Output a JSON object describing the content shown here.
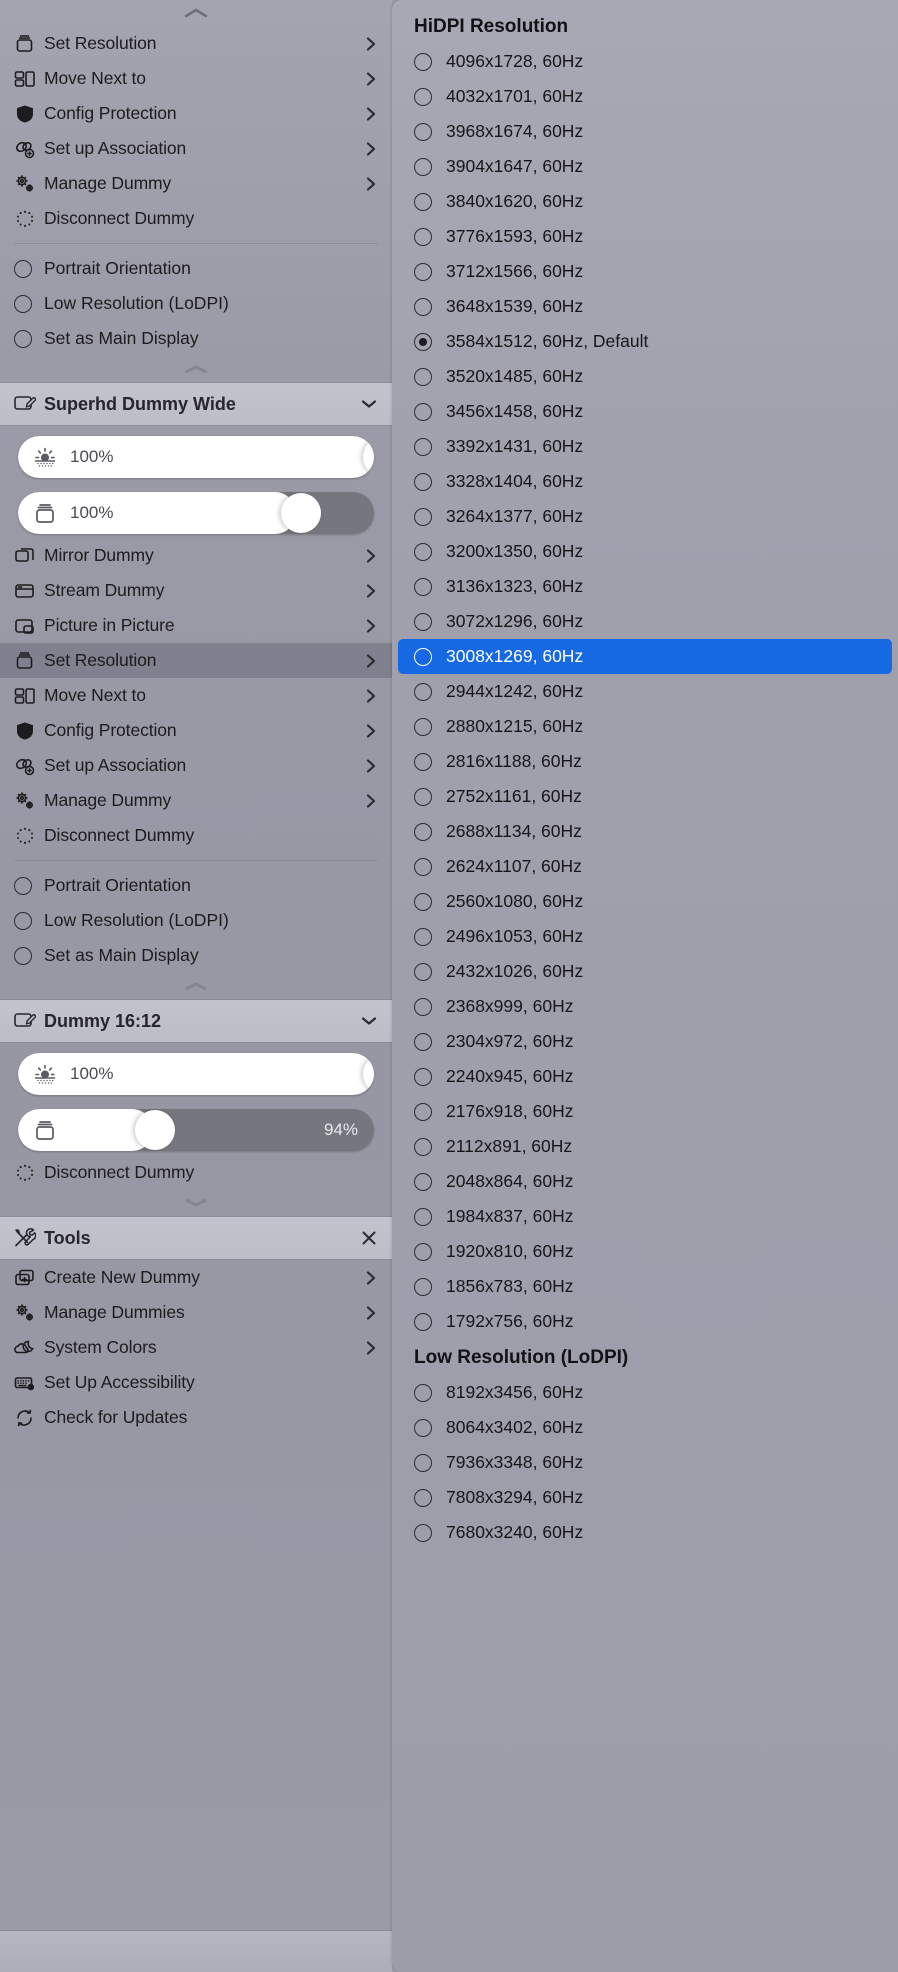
{
  "left_panel": {
    "top_chevron_icon": "chevron-up-icon",
    "display1_menu": [
      {
        "icon": "display-icon",
        "label": "Set Resolution",
        "submenu": true
      },
      {
        "icon": "move-next-to-icon",
        "label": "Move Next to",
        "submenu": true
      },
      {
        "icon": "shield-icon",
        "label": "Config Protection",
        "submenu": true
      },
      {
        "icon": "association-icon",
        "label": "Set up Association",
        "submenu": true
      },
      {
        "icon": "gears-icon",
        "label": "Manage Dummy",
        "submenu": true
      },
      {
        "icon": "disconnect-icon",
        "label": "Disconnect Dummy",
        "submenu": false
      }
    ],
    "display1_toggles": [
      {
        "label": "Portrait Orientation",
        "checked": false
      },
      {
        "label": "Low Resolution (LoDPI)",
        "checked": false
      },
      {
        "label": "Set as Main Display",
        "checked": false
      }
    ],
    "section_superhd": {
      "icon": "display-edit-icon",
      "title": "Superhd Dummy Wide",
      "chevron": "chevron-down-icon",
      "sliders": [
        {
          "icon": "brightness-icon",
          "value_label": "100%",
          "fill_percent": 100,
          "knob_percent": 97,
          "value_side": "left"
        },
        {
          "icon": "resolution-icon",
          "value_label": "100%",
          "fill_percent": 78,
          "knob_percent": 74,
          "value_side": "left"
        }
      ],
      "menu": [
        {
          "icon": "mirror-icon",
          "label": "Mirror Dummy",
          "submenu": true
        },
        {
          "icon": "stream-icon",
          "label": "Stream Dummy",
          "submenu": true
        },
        {
          "icon": "pip-icon",
          "label": "Picture in Picture",
          "submenu": true
        },
        {
          "icon": "display-icon",
          "label": "Set Resolution",
          "submenu": true,
          "highlighted": true
        },
        {
          "icon": "move-next-to-icon",
          "label": "Move Next to",
          "submenu": true
        },
        {
          "icon": "shield-icon",
          "label": "Config Protection",
          "submenu": true
        },
        {
          "icon": "association-icon",
          "label": "Set up Association",
          "submenu": true
        },
        {
          "icon": "gears-icon",
          "label": "Manage Dummy",
          "submenu": true
        },
        {
          "icon": "disconnect-icon",
          "label": "Disconnect Dummy",
          "submenu": false
        }
      ],
      "toggles": [
        {
          "label": "Portrait Orientation",
          "checked": false
        },
        {
          "label": "Low Resolution (LoDPI)",
          "checked": false
        },
        {
          "label": "Set as Main Display",
          "checked": false
        }
      ]
    },
    "section_dummy1612": {
      "icon": "display-edit-icon",
      "title": "Dummy 16:12",
      "chevron": "chevron-down-icon",
      "sliders": [
        {
          "icon": "brightness-icon",
          "value_label": "100%",
          "fill_percent": 100,
          "knob_percent": 97,
          "value_side": "left"
        },
        {
          "icon": "resolution-icon",
          "value_label": "94%",
          "fill_percent": 38,
          "knob_percent": 33,
          "value_side": "right"
        }
      ],
      "menu": [
        {
          "icon": "disconnect-icon",
          "label": "Disconnect Dummy",
          "submenu": false
        }
      ]
    },
    "section_tools": {
      "icon": "tools-icon",
      "title": "Tools",
      "close": "close-icon",
      "menu": [
        {
          "icon": "create-dummy-icon",
          "label": "Create New Dummy",
          "submenu": true
        },
        {
          "icon": "gears-icon",
          "label": "Manage Dummies",
          "submenu": true
        },
        {
          "icon": "moon-cloud-icon",
          "label": "System Colors",
          "submenu": true
        },
        {
          "icon": "keyboard-icon",
          "label": "Set Up Accessibility",
          "submenu": false
        },
        {
          "icon": "refresh-icon",
          "label": "Check for Updates",
          "submenu": false
        }
      ]
    }
  },
  "right_panel": {
    "groups": [
      {
        "title": "HiDPI Resolution",
        "items": [
          {
            "label": "4096x1728, 60Hz",
            "checked": false,
            "highlighted": false
          },
          {
            "label": "4032x1701, 60Hz",
            "checked": false,
            "highlighted": false
          },
          {
            "label": "3968x1674, 60Hz",
            "checked": false,
            "highlighted": false
          },
          {
            "label": "3904x1647, 60Hz",
            "checked": false,
            "highlighted": false
          },
          {
            "label": "3840x1620, 60Hz",
            "checked": false,
            "highlighted": false
          },
          {
            "label": "3776x1593, 60Hz",
            "checked": false,
            "highlighted": false
          },
          {
            "label": "3712x1566, 60Hz",
            "checked": false,
            "highlighted": false
          },
          {
            "label": "3648x1539, 60Hz",
            "checked": false,
            "highlighted": false
          },
          {
            "label": "3584x1512, 60Hz, Default",
            "checked": true,
            "highlighted": false
          },
          {
            "label": "3520x1485, 60Hz",
            "checked": false,
            "highlighted": false
          },
          {
            "label": "3456x1458, 60Hz",
            "checked": false,
            "highlighted": false
          },
          {
            "label": "3392x1431, 60Hz",
            "checked": false,
            "highlighted": false
          },
          {
            "label": "3328x1404, 60Hz",
            "checked": false,
            "highlighted": false
          },
          {
            "label": "3264x1377, 60Hz",
            "checked": false,
            "highlighted": false
          },
          {
            "label": "3200x1350, 60Hz",
            "checked": false,
            "highlighted": false
          },
          {
            "label": "3136x1323, 60Hz",
            "checked": false,
            "highlighted": false
          },
          {
            "label": "3072x1296, 60Hz",
            "checked": false,
            "highlighted": false
          },
          {
            "label": "3008x1269, 60Hz",
            "checked": false,
            "highlighted": true
          },
          {
            "label": "2944x1242, 60Hz",
            "checked": false,
            "highlighted": false
          },
          {
            "label": "2880x1215, 60Hz",
            "checked": false,
            "highlighted": false
          },
          {
            "label": "2816x1188, 60Hz",
            "checked": false,
            "highlighted": false
          },
          {
            "label": "2752x1161, 60Hz",
            "checked": false,
            "highlighted": false
          },
          {
            "label": "2688x1134, 60Hz",
            "checked": false,
            "highlighted": false
          },
          {
            "label": "2624x1107, 60Hz",
            "checked": false,
            "highlighted": false
          },
          {
            "label": "2560x1080, 60Hz",
            "checked": false,
            "highlighted": false
          },
          {
            "label": "2496x1053, 60Hz",
            "checked": false,
            "highlighted": false
          },
          {
            "label": "2432x1026, 60Hz",
            "checked": false,
            "highlighted": false
          },
          {
            "label": "2368x999, 60Hz",
            "checked": false,
            "highlighted": false
          },
          {
            "label": "2304x972, 60Hz",
            "checked": false,
            "highlighted": false
          },
          {
            "label": "2240x945, 60Hz",
            "checked": false,
            "highlighted": false
          },
          {
            "label": "2176x918, 60Hz",
            "checked": false,
            "highlighted": false
          },
          {
            "label": "2112x891, 60Hz",
            "checked": false,
            "highlighted": false
          },
          {
            "label": "2048x864, 60Hz",
            "checked": false,
            "highlighted": false
          },
          {
            "label": "1984x837, 60Hz",
            "checked": false,
            "highlighted": false
          },
          {
            "label": "1920x810, 60Hz",
            "checked": false,
            "highlighted": false
          },
          {
            "label": "1856x783, 60Hz",
            "checked": false,
            "highlighted": false
          },
          {
            "label": "1792x756, 60Hz",
            "checked": false,
            "highlighted": false
          }
        ]
      },
      {
        "title": "Low Resolution (LoDPI)",
        "items": [
          {
            "label": "8192x3456, 60Hz",
            "checked": false,
            "highlighted": false
          },
          {
            "label": "8064x3402, 60Hz",
            "checked": false,
            "highlighted": false
          },
          {
            "label": "7936x3348, 60Hz",
            "checked": false,
            "highlighted": false
          },
          {
            "label": "7808x3294, 60Hz",
            "checked": false,
            "highlighted": false
          },
          {
            "label": "7680x3240, 60Hz",
            "checked": false,
            "highlighted": false
          }
        ]
      }
    ]
  },
  "colors": {
    "selection_blue": "#1668e3",
    "panel_bg": "#9b9ba8",
    "section_header_bg": "#c0c0cb",
    "highlight_row": "#80808e"
  }
}
